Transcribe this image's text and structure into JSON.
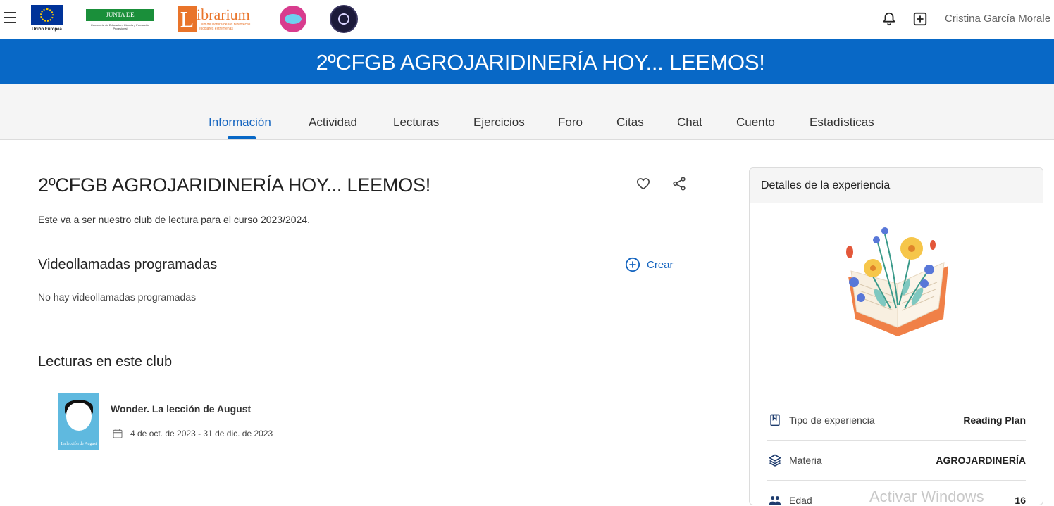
{
  "topbar": {
    "eu_caption": "Unión Europea",
    "junta_name": "JUNTA DE EXTREMADURA",
    "junta_sub": "Consejería de Educación, Ciencia y Formación Profesional",
    "librarium_letter": "L",
    "librarium_word": "ibrarium",
    "librarium_tag": "Club de lectura de las bibliotecas escolares extremeñas",
    "user_name": "Cristina García Morale"
  },
  "banner": {
    "title": "2ºCFGB AGROJARIDINERÍA HOY... LEEMOS!"
  },
  "tabs": [
    {
      "label": "Información",
      "active": true
    },
    {
      "label": "Actividad"
    },
    {
      "label": "Lecturas"
    },
    {
      "label": "Ejercicios"
    },
    {
      "label": "Foro"
    },
    {
      "label": "Citas"
    },
    {
      "label": "Chat"
    },
    {
      "label": "Cuento"
    },
    {
      "label": "Estadísticas"
    }
  ],
  "main": {
    "title": "2ºCFGB AGROJARIDINERÍA HOY... LEEMOS!",
    "description": "Este va a ser nuestro club de lectura para el curso 2023/2024.",
    "video_heading": "Videollamadas programadas",
    "create_label": "Crear",
    "no_video_msg": "No hay videollamadas programadas",
    "readings_heading": "Lecturas en este club",
    "book": {
      "cover_title": "La lección de August",
      "name": "Wonder. La lección de August",
      "dates": "4 de oct. de 2023 - 31 de dic. de 2023"
    }
  },
  "card": {
    "title": "Detalles de la experiencia",
    "rows": [
      {
        "label": "Tipo de experiencia",
        "value": "Reading Plan",
        "icon": "book-icon"
      },
      {
        "label": "Materia",
        "value": "AGROJARDINERÍA",
        "icon": "layers-icon"
      },
      {
        "label": "Edad",
        "value": "16",
        "icon": "people-icon"
      }
    ]
  },
  "watermark": "Activar Windows",
  "colors": {
    "brand_blue": "#0868c6",
    "link_blue": "#1565c0",
    "tab_bg": "#f5f5f5"
  }
}
